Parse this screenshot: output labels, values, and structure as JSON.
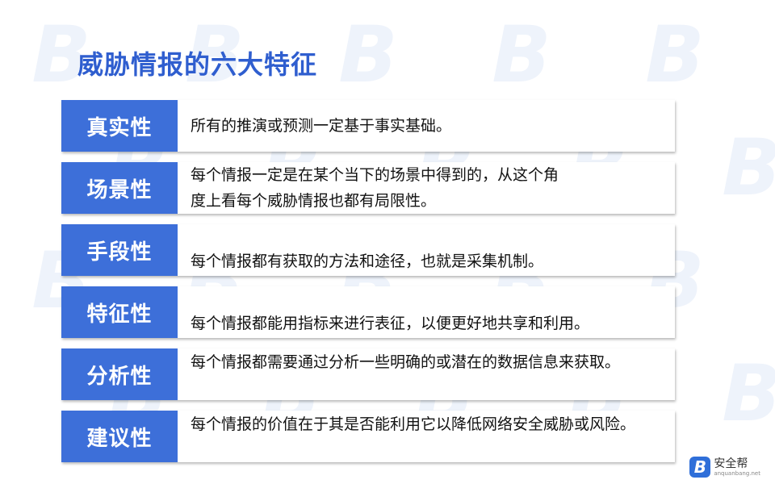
{
  "title": "威胁情报的六大特征",
  "watermark_glyph": "B",
  "rows": [
    {
      "label": "真实性",
      "desc": "所有的推演或预测一定基于事实基础。"
    },
    {
      "label": "场景性",
      "desc": "每个情报一定是在某个当下的场景中得到的，从这个角\n度上看每个威胁情报也都有局限性。"
    },
    {
      "label": "手段性",
      "desc": "每个情报都有获取的方法和途径，也就是采集机制。"
    },
    {
      "label": "特征性",
      "desc": "每个情报都能用指标来进行表征，以便更好地共享和利用。"
    },
    {
      "label": "分析性",
      "desc": "每个情报都需要通过分析一些明确的或潜在的数据信息来获取。"
    },
    {
      "label": "建议性",
      "desc": "每个情报的价值在于其是否能利用它以降低网络安全威胁或风险。"
    }
  ],
  "logo": {
    "glyph": "B",
    "name": "安全帮",
    "sub": "anquanbang.net"
  },
  "colors": {
    "title": "#2f5ecf",
    "label_bg": "#3d6fd9",
    "watermark": "#eef3fb"
  }
}
